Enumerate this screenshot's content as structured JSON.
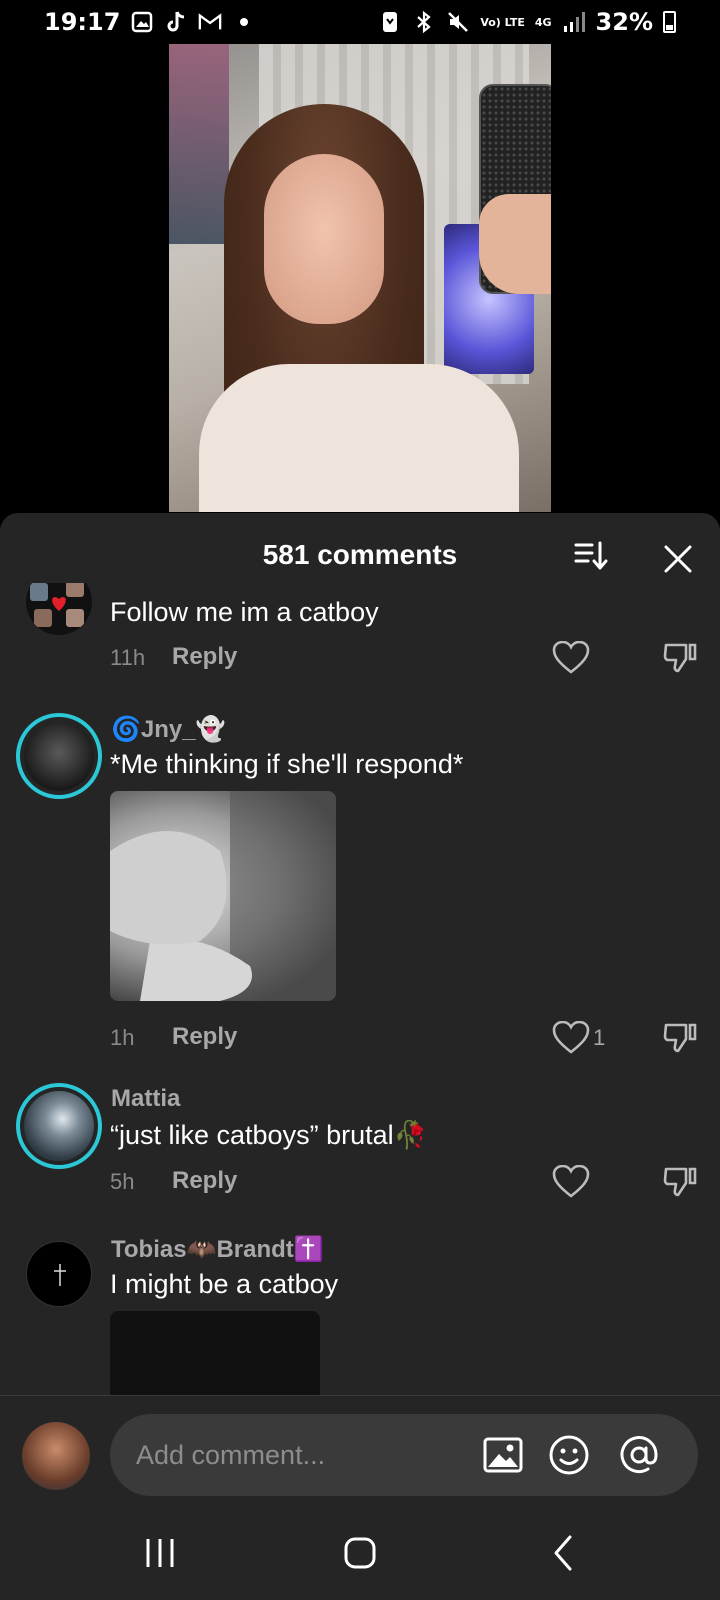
{
  "status_bar": {
    "time": "19:17",
    "icons_left": [
      "gallery-icon",
      "tiktok-icon",
      "gmail-icon",
      "dot-icon"
    ],
    "icons_right": [
      "nfc-icon",
      "bluetooth-icon",
      "mute-icon",
      "volte-icon",
      "4g-icon",
      "signal-icon"
    ],
    "volte_label": "Vo) LTE",
    "network_label": "4G",
    "battery": "32%"
  },
  "sheet": {
    "title": "581 comments"
  },
  "comments": [
    {
      "user": "",
      "text": "Follow me im a catboy",
      "time": "11h",
      "reply_label": "Reply",
      "likes": ""
    },
    {
      "user": "🌀Jny_👻",
      "text": "*Me thinking if she'll respond*",
      "time": "1h",
      "reply_label": "Reply",
      "likes": "1",
      "has_image": true
    },
    {
      "user": "Mattia",
      "text": "“just like catboys” brutal🥀",
      "time": "5h",
      "reply_label": "Reply",
      "likes": ""
    },
    {
      "user": "Tobias🦇Brandt✝️",
      "text": "I might be a catboy",
      "has_image": true
    }
  ],
  "input": {
    "placeholder": "Add comment..."
  },
  "colors": {
    "sheet_bg": "#252525",
    "accent_ring": "#2cc8d8",
    "muted_text": "#a8a8a8"
  }
}
